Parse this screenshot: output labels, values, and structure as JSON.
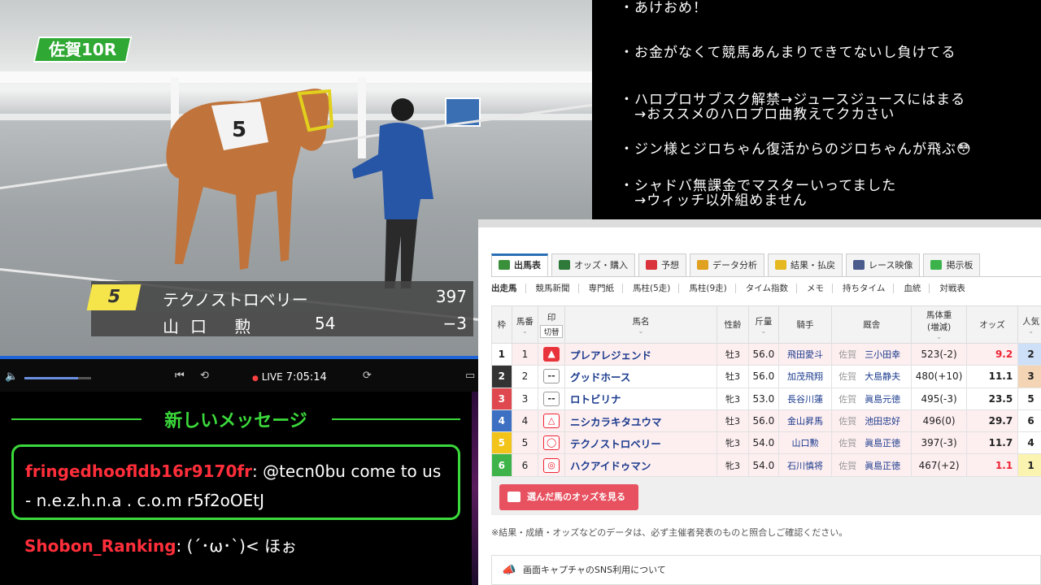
{
  "video": {
    "race_tag": "佐賀10R",
    "caption": {
      "number": "5",
      "horse_name": "テクノストロベリー",
      "body_weight": "397",
      "jockey": "山口 勲",
      "jockey_weight": "54",
      "weight_diff": "−3"
    },
    "saddle_number": "5"
  },
  "player": {
    "live_label": "LIVE",
    "time": "7:05:14",
    "volume_level_fraction": 0.8
  },
  "notes": [
    "・あけおめ！",
    "・お金がなくて競馬あんまりできてないし負けてる",
    "・ハロプロサブスク解禁→ジュースジュースにはまる",
    "　→おススメのハロプロ曲教えてクカさい",
    "・ジン様とジロちゃん復活からのジロちゃんが飛ぶ😳",
    "・シャドバ無課金でマスターいってました",
    "　→ウィッチ以外組めません"
  ],
  "chat": {
    "header": "新しいメッセージ",
    "messages": [
      {
        "user": "fringedhoofldb16r9170fr",
        "text": ": @tecn0bu come to us - n.e.z.h.n.a . c.o.m r5f2oOEtJ"
      },
      {
        "user": "Shobon_Ranking",
        "text": ": (´･ω･`)< ほぉ"
      }
    ]
  },
  "racecard": {
    "tabs": [
      {
        "label": "出馬表",
        "active": true,
        "icon": "table-icon",
        "color": "#3a8f3a"
      },
      {
        "label": "オッズ・購入",
        "active": false,
        "icon": "odds-icon",
        "color": "#2f7a3a"
      },
      {
        "label": "予想",
        "active": false,
        "icon": "target-icon",
        "color": "#d9333b"
      },
      {
        "label": "データ分析",
        "active": false,
        "icon": "bar-chart-icon",
        "color": "#e0a020"
      },
      {
        "label": "結果・払戻",
        "active": false,
        "icon": "coins-icon",
        "color": "#e6b820"
      },
      {
        "label": "レース映像",
        "active": false,
        "icon": "video-icon",
        "color": "#4a5b8c"
      },
      {
        "label": "掲示板",
        "active": false,
        "icon": "chat-icon",
        "color": "#3bb34a"
      }
    ],
    "subtabs": [
      "出走馬",
      "競馬新聞",
      "専門紙",
      "馬柱(5走)",
      "馬柱(9走)",
      "タイム指数",
      "メモ",
      "持ちタイム",
      "血統",
      "対戦表"
    ],
    "headers": {
      "waku": "枠",
      "umaban": "馬番",
      "mark": "印",
      "mark_toggle": "切替",
      "name": "馬名",
      "sexage": "性齢",
      "kinryo": "斤量",
      "jockey": "騎手",
      "trainer": "厩舎",
      "weight": "馬体重",
      "weight_sub": "(増減)",
      "odds": "オッズ",
      "popularity": "人気"
    },
    "rows": [
      {
        "waku": "1",
        "waku_color": "#ffffff",
        "waku_text": "#222222",
        "num": "1",
        "mark": "▲",
        "mark_style": "red",
        "name": "プレアレジェンド",
        "sexage": "牡3",
        "kinryo": "56.0",
        "jockey": "飛田愛斗",
        "trainer_pre": "佐賀",
        "trainer": "三小田幸",
        "weight": "523(-2)",
        "odds": "9.2",
        "odds_hot": true,
        "pop": "2",
        "pop_bg": "#cde0f7",
        "pink": true
      },
      {
        "waku": "2",
        "waku_color": "#333333",
        "waku_text": "#ffffff",
        "num": "2",
        "mark": "--",
        "mark_style": "plain",
        "name": "グッドホース",
        "sexage": "牡3",
        "kinryo": "56.0",
        "jockey": "加茂飛翔",
        "trainer_pre": "佐賀",
        "trainer": "大島静夫",
        "weight": "480(+10)",
        "odds": "11.1",
        "odds_hot": false,
        "pop": "3",
        "pop_bg": "#f3d5b5",
        "pink": false
      },
      {
        "waku": "3",
        "waku_color": "#e0484f",
        "waku_text": "#ffffff",
        "num": "3",
        "mark": "--",
        "mark_style": "plain",
        "name": "ロトビリナ",
        "sexage": "牝3",
        "kinryo": "53.0",
        "jockey": "長谷川蓮",
        "trainer_pre": "佐賀",
        "trainer": "眞島元徳",
        "weight": "495(-3)",
        "odds": "23.5",
        "odds_hot": false,
        "pop": "5",
        "pop_bg": "#ffffff",
        "pink": false
      },
      {
        "waku": "4",
        "waku_color": "#3d6fc2",
        "waku_text": "#ffffff",
        "num": "4",
        "mark": "△",
        "mark_style": "tri",
        "name": "ニシカラキタユウマ",
        "sexage": "牡3",
        "kinryo": "56.0",
        "jockey": "金山昇馬",
        "trainer_pre": "佐賀",
        "trainer": "池田忠好",
        "weight": "496(0)",
        "odds": "29.7",
        "odds_hot": false,
        "pop": "6",
        "pop_bg": "#ffffff",
        "pink": true
      },
      {
        "waku": "5",
        "waku_color": "#f2c318",
        "waku_text": "#ffffff",
        "num": "5",
        "mark": "◯",
        "mark_style": "circ",
        "name": "テクノストロベリー",
        "sexage": "牝3",
        "kinryo": "54.0",
        "jockey": "山口勲",
        "trainer_pre": "佐賀",
        "trainer": "眞島正徳",
        "weight": "397(-3)",
        "odds": "11.7",
        "odds_hot": false,
        "pop": "4",
        "pop_bg": "#ffffff",
        "pink": true
      },
      {
        "waku": "6",
        "waku_color": "#3db34a",
        "waku_text": "#ffffff",
        "num": "6",
        "mark": "◎",
        "mark_style": "circ",
        "name": "ハクアイドゥマン",
        "sexage": "牝3",
        "kinryo": "54.0",
        "jockey": "石川慎将",
        "trainer_pre": "佐賀",
        "trainer": "眞島正徳",
        "weight": "467(+2)",
        "odds": "1.1",
        "odds_hot": true,
        "pop": "1",
        "pop_bg": "#fbf3b0",
        "pink": true
      }
    ],
    "odds_button": "選んだ馬のオッズを見る",
    "notice": "※結果・成績・オッズなどのデータは、必ず主催者発表のものと照合しご確認ください。",
    "sns_notice": "画面キャプチャのSNS利用について"
  }
}
